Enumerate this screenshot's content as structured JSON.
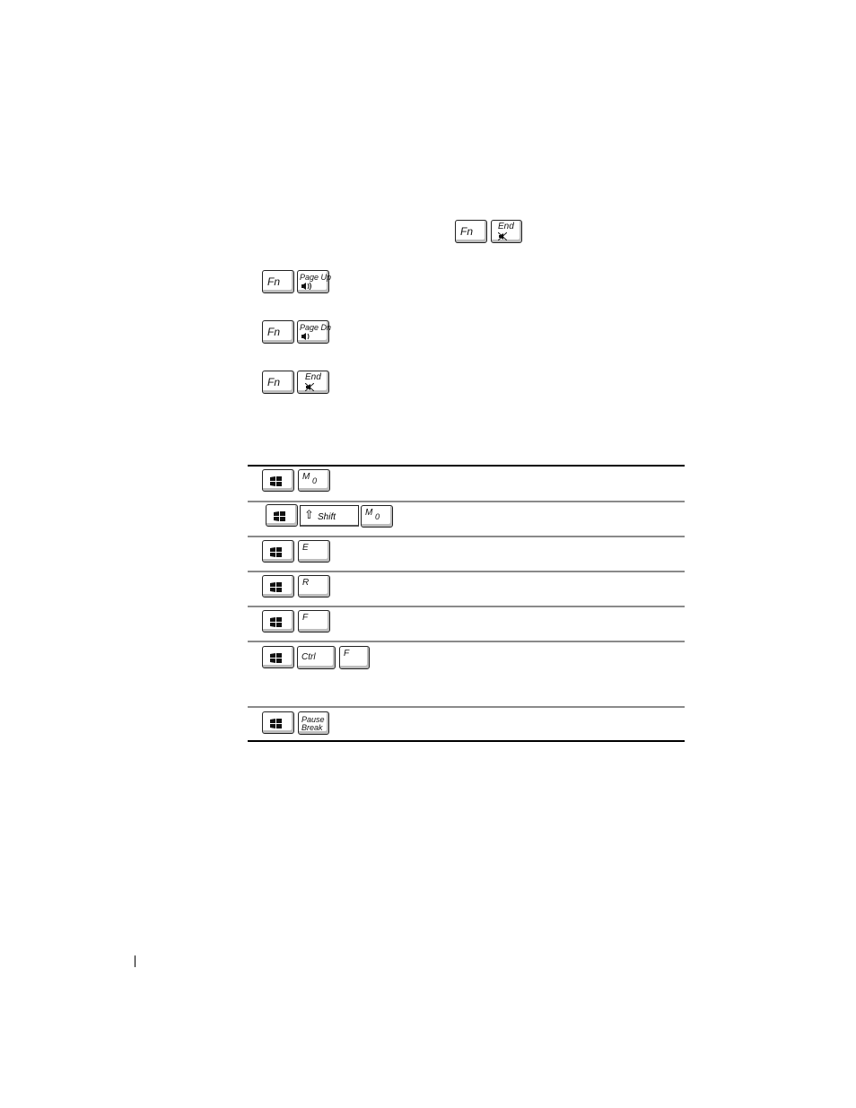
{
  "inline_combo": {
    "keys": [
      "Fn",
      "End"
    ],
    "icon": "mute-icon"
  },
  "fn_combos": [
    {
      "keys": [
        "Fn",
        "Page Up"
      ],
      "icon": "volume-up-icon"
    },
    {
      "keys": [
        "Fn",
        "Page Dn"
      ],
      "icon": "volume-down-icon"
    },
    {
      "keys": [
        "Fn",
        "End"
      ],
      "icon": "mute-icon"
    }
  ],
  "windows_table": {
    "rows": [
      {
        "keys": [
          "windows-logo",
          "M"
        ],
        "sub": "0"
      },
      {
        "keys": [
          "windows-logo",
          "Shift",
          "M"
        ],
        "sub": "0"
      },
      {
        "keys": [
          "windows-logo",
          "E"
        ]
      },
      {
        "keys": [
          "windows-logo",
          "R"
        ]
      },
      {
        "keys": [
          "windows-logo",
          "F"
        ]
      },
      {
        "keys": [
          "windows-logo",
          "Ctrl",
          "F"
        ]
      },
      {
        "keys": [
          "windows-logo",
          "Pause",
          "Break"
        ]
      }
    ]
  },
  "labels": {
    "fn": "Fn",
    "end": "End",
    "page_up": "Page Up",
    "page_dn": "Page Dn",
    "m": "M",
    "m_sub": "0",
    "shift": "Shift",
    "shift_arrow": "⇧",
    "e": "E",
    "r": "R",
    "f": "F",
    "ctrl": "Ctrl",
    "pause": "Pause",
    "break": "Break",
    "vol_up_glyph": "🔊",
    "vol_down_glyph": "🔉",
    "mute_glyph": "🔇"
  }
}
